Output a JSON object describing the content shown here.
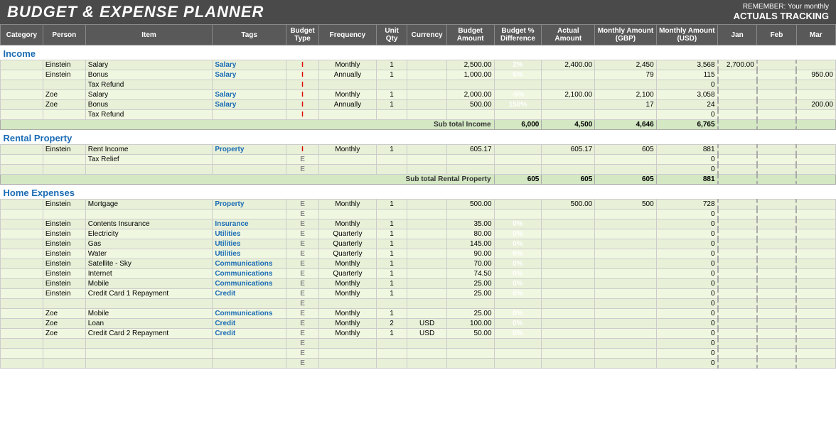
{
  "header": {
    "title": "BUDGET & EXPENSE PLANNER",
    "remember_label": "REMEMBER: Your monthly",
    "actuals_label": "ACTUALS TRACKING"
  },
  "columns": {
    "category": "Category",
    "person": "Person",
    "item": "Item",
    "tags": "Tags",
    "budget_type": "Budget Type",
    "frequency": "Frequency",
    "unit_qty": "Unit Qty",
    "currency": "Currency",
    "budget_amount": "Budget Amount",
    "budget_pct": "Budget % Difference",
    "actual_amount": "Actual Amount",
    "monthly_gbp": "Monthly Amount (GBP)",
    "monthly_usd": "Monthly Amount (USD)",
    "jan": "Jan",
    "feb": "Feb",
    "mar": "Mar"
  },
  "sections": {
    "income": {
      "label": "Income",
      "rows": [
        {
          "person": "Einstein",
          "item": "Salary",
          "tags": "Salary",
          "type": "I",
          "frequency": "Monthly",
          "unit_qty": "1",
          "currency": "",
          "budget_amount": "2,500.00",
          "pct": "2%",
          "pct_class": "pct-green",
          "actual": "2,400.00",
          "mgbp": "2,450",
          "musd": "3,568",
          "jan": "2,700.00",
          "feb": "",
          "mar": ""
        },
        {
          "person": "Einstein",
          "item": "Bonus",
          "tags": "Salary",
          "type": "I",
          "frequency": "Annually",
          "unit_qty": "1",
          "currency": "",
          "budget_amount": "1,000.00",
          "pct": "5%",
          "pct_class": "pct-green-light",
          "actual": "",
          "mgbp": "79",
          "musd": "115",
          "jan": "",
          "feb": "",
          "mar": "950.00"
        },
        {
          "person": "",
          "item": "Tax Refund",
          "tags": "",
          "type": "I",
          "frequency": "",
          "unit_qty": "",
          "currency": "",
          "budget_amount": "",
          "pct": "",
          "pct_class": "",
          "actual": "",
          "mgbp": "",
          "musd": "0",
          "jan": "",
          "feb": "",
          "mar": ""
        },
        {
          "person": "Zoe",
          "item": "Salary",
          "tags": "Salary",
          "type": "I",
          "frequency": "Monthly",
          "unit_qty": "1",
          "currency": "",
          "budget_amount": "2,000.00",
          "pct": "-5%",
          "pct_class": "pct-red",
          "actual": "2,100.00",
          "mgbp": "2,100",
          "musd": "3,058",
          "jan": "",
          "feb": "",
          "mar": ""
        },
        {
          "person": "Zoe",
          "item": "Bonus",
          "tags": "Salary",
          "type": "I",
          "frequency": "Annually",
          "unit_qty": "1",
          "currency": "",
          "budget_amount": "500.00",
          "pct": "150%",
          "pct_class": "pct-orange",
          "actual": "",
          "mgbp": "17",
          "musd": "24",
          "jan": "",
          "feb": "",
          "mar": "200.00"
        },
        {
          "person": "",
          "item": "Tax Refund",
          "tags": "",
          "type": "I",
          "frequency": "",
          "unit_qty": "",
          "currency": "",
          "budget_amount": "",
          "pct": "",
          "pct_class": "",
          "actual": "",
          "mgbp": "",
          "musd": "0",
          "jan": "",
          "feb": "",
          "mar": ""
        }
      ],
      "subtotal_label": "Sub total Income",
      "subtotal_budget": "6,000",
      "subtotal_actual": "4,500",
      "subtotal_mgbp": "4,646",
      "subtotal_musd": "6,765"
    },
    "rental": {
      "label": "Rental Property",
      "rows": [
        {
          "person": "Einstein",
          "item": "Rent Income",
          "tags": "Property",
          "type": "I",
          "frequency": "Monthly",
          "unit_qty": "1",
          "currency": "",
          "budget_amount": "605.17",
          "pct": "",
          "pct_class": "",
          "actual": "605.17",
          "mgbp": "605",
          "musd": "881",
          "jan": "",
          "feb": "",
          "mar": ""
        },
        {
          "person": "",
          "item": "Tax Relief",
          "tags": "",
          "type": "E",
          "frequency": "",
          "unit_qty": "",
          "currency": "",
          "budget_amount": "",
          "pct": "",
          "pct_class": "",
          "actual": "",
          "mgbp": "",
          "musd": "0",
          "jan": "",
          "feb": "",
          "mar": ""
        },
        {
          "person": "",
          "item": "",
          "tags": "",
          "type": "E",
          "frequency": "",
          "unit_qty": "",
          "currency": "",
          "budget_amount": "",
          "pct": "",
          "pct_class": "",
          "actual": "",
          "mgbp": "",
          "musd": "0",
          "jan": "",
          "feb": "",
          "mar": ""
        }
      ],
      "subtotal_label": "Sub total Rental Property",
      "subtotal_budget": "605",
      "subtotal_actual": "605",
      "subtotal_mgbp": "605",
      "subtotal_musd": "881"
    },
    "home_expenses": {
      "label": "Home Expenses",
      "rows": [
        {
          "person": "Einstein",
          "item": "Mortgage",
          "tags": "Property",
          "type": "E",
          "frequency": "Monthly",
          "unit_qty": "1",
          "currency": "",
          "budget_amount": "500.00",
          "pct": "",
          "pct_class": "",
          "actual": "500.00",
          "mgbp": "500",
          "musd": "728",
          "jan": "",
          "feb": "",
          "mar": ""
        },
        {
          "person": "",
          "item": "",
          "tags": "",
          "type": "E",
          "frequency": "",
          "unit_qty": "",
          "currency": "",
          "budget_amount": "",
          "pct": "",
          "pct_class": "",
          "actual": "",
          "mgbp": "",
          "musd": "0",
          "jan": "",
          "feb": "",
          "mar": ""
        },
        {
          "person": "Einstein",
          "item": "Contents Insurance",
          "tags": "Insurance",
          "type": "E",
          "frequency": "Monthly",
          "unit_qty": "1",
          "currency": "",
          "budget_amount": "35.00",
          "pct": "0%",
          "pct_class": "pct-zero",
          "actual": "",
          "mgbp": "",
          "musd": "0",
          "jan": "",
          "feb": "",
          "mar": ""
        },
        {
          "person": "Einstein",
          "item": "Electricity",
          "tags": "Utilities",
          "type": "E",
          "frequency": "Quarterly",
          "unit_qty": "1",
          "currency": "",
          "budget_amount": "80.00",
          "pct": "0%",
          "pct_class": "pct-zero",
          "actual": "",
          "mgbp": "",
          "musd": "0",
          "jan": "",
          "feb": "",
          "mar": ""
        },
        {
          "person": "Einstein",
          "item": "Gas",
          "tags": "Utilities",
          "type": "E",
          "frequency": "Quarterly",
          "unit_qty": "1",
          "currency": "",
          "budget_amount": "145.00",
          "pct": "0%",
          "pct_class": "pct-zero",
          "actual": "",
          "mgbp": "",
          "musd": "0",
          "jan": "",
          "feb": "",
          "mar": ""
        },
        {
          "person": "Einstein",
          "item": "Water",
          "tags": "Utilities",
          "type": "E",
          "frequency": "Quarterly",
          "unit_qty": "1",
          "currency": "",
          "budget_amount": "90.00",
          "pct": "0%",
          "pct_class": "pct-zero",
          "actual": "",
          "mgbp": "",
          "musd": "0",
          "jan": "",
          "feb": "",
          "mar": ""
        },
        {
          "person": "Einstein",
          "item": "Satellite - Sky",
          "tags": "Communications",
          "type": "E",
          "frequency": "Monthly",
          "unit_qty": "1",
          "currency": "",
          "budget_amount": "70.00",
          "pct": "0%",
          "pct_class": "pct-zero",
          "actual": "",
          "mgbp": "",
          "musd": "0",
          "jan": "",
          "feb": "",
          "mar": ""
        },
        {
          "person": "Einstein",
          "item": "Internet",
          "tags": "Communications",
          "type": "E",
          "frequency": "Quarterly",
          "unit_qty": "1",
          "currency": "",
          "budget_amount": "74.50",
          "pct": "0%",
          "pct_class": "pct-zero",
          "actual": "",
          "mgbp": "",
          "musd": "0",
          "jan": "",
          "feb": "",
          "mar": ""
        },
        {
          "person": "Einstein",
          "item": "Mobile",
          "tags": "Communications",
          "type": "E",
          "frequency": "Monthly",
          "unit_qty": "1",
          "currency": "",
          "budget_amount": "25.00",
          "pct": "0%",
          "pct_class": "pct-zero",
          "actual": "",
          "mgbp": "",
          "musd": "0",
          "jan": "",
          "feb": "",
          "mar": ""
        },
        {
          "person": "Einstein",
          "item": "Credit Card 1 Repayment",
          "tags": "Credit",
          "type": "E",
          "frequency": "Monthly",
          "unit_qty": "1",
          "currency": "",
          "budget_amount": "25.00",
          "pct": "0%",
          "pct_class": "pct-zero",
          "actual": "",
          "mgbp": "",
          "musd": "0",
          "jan": "",
          "feb": "",
          "mar": ""
        },
        {
          "person": "",
          "item": "",
          "tags": "",
          "type": "E",
          "frequency": "",
          "unit_qty": "",
          "currency": "",
          "budget_amount": "",
          "pct": "",
          "pct_class": "",
          "actual": "",
          "mgbp": "",
          "musd": "0",
          "jan": "",
          "feb": "",
          "mar": ""
        },
        {
          "person": "Zoe",
          "item": "Mobile",
          "tags": "Communications",
          "type": "E",
          "frequency": "Monthly",
          "unit_qty": "1",
          "currency": "",
          "budget_amount": "25.00",
          "pct": "0%",
          "pct_class": "pct-zero",
          "actual": "",
          "mgbp": "",
          "musd": "0",
          "jan": "",
          "feb": "",
          "mar": ""
        },
        {
          "person": "Zoe",
          "item": "Loan",
          "tags": "Credit",
          "type": "E",
          "frequency": "Monthly",
          "unit_qty": "2",
          "currency": "USD",
          "budget_amount": "100.00",
          "pct": "0%",
          "pct_class": "pct-zero",
          "actual": "",
          "mgbp": "",
          "musd": "0",
          "jan": "",
          "feb": "",
          "mar": ""
        },
        {
          "person": "Zoe",
          "item": "Credit Card 2 Repayment",
          "tags": "Credit",
          "type": "E",
          "frequency": "Monthly",
          "unit_qty": "1",
          "currency": "USD",
          "budget_amount": "50.00",
          "pct": "0%",
          "pct_class": "pct-zero",
          "actual": "",
          "mgbp": "",
          "musd": "0",
          "jan": "",
          "feb": "",
          "mar": ""
        },
        {
          "person": "",
          "item": "",
          "tags": "",
          "type": "E",
          "frequency": "",
          "unit_qty": "",
          "currency": "",
          "budget_amount": "",
          "pct": "",
          "pct_class": "",
          "actual": "",
          "mgbp": "",
          "musd": "0",
          "jan": "",
          "feb": "",
          "mar": ""
        },
        {
          "person": "",
          "item": "",
          "tags": "",
          "type": "E",
          "frequency": "",
          "unit_qty": "",
          "currency": "",
          "budget_amount": "",
          "pct": "",
          "pct_class": "",
          "actual": "",
          "mgbp": "",
          "musd": "0",
          "jan": "",
          "feb": "",
          "mar": ""
        },
        {
          "person": "",
          "item": "",
          "tags": "",
          "type": "E",
          "frequency": "",
          "unit_qty": "",
          "currency": "",
          "budget_amount": "",
          "pct": "",
          "pct_class": "",
          "actual": "",
          "mgbp": "",
          "musd": "0",
          "jan": "",
          "feb": "",
          "mar": ""
        }
      ]
    }
  }
}
